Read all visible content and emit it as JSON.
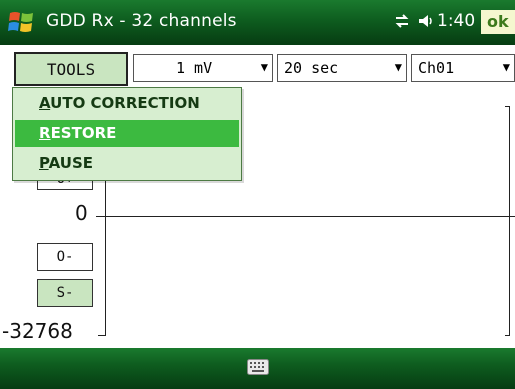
{
  "titlebar": {
    "title": "GDD Rx - 32 channels",
    "connectivity_icon": "connectivity-icon",
    "volume_icon": "speaker-icon",
    "clock": "1:40",
    "ok_label": "ok"
  },
  "toolbar": {
    "tools_label": "TOOLS",
    "gain": {
      "value": "1 mV"
    },
    "duration": {
      "value": "20 sec"
    },
    "channel": {
      "value": "Ch01"
    }
  },
  "menu": {
    "items": [
      {
        "first": "A",
        "rest": "UTO CORRECTION",
        "selected": false
      },
      {
        "first": "R",
        "rest": "ESTORE",
        "selected": true
      },
      {
        "first": "P",
        "rest": "AUSE",
        "selected": false
      }
    ]
  },
  "graph": {
    "y_zero": "0",
    "y_min": "-32768",
    "buttons": {
      "hidden": "O+",
      "offset_minus": "O-",
      "scale_minus": "S-"
    }
  },
  "bottombar": {
    "keyboard_icon": "keyboard-icon"
  },
  "colors": {
    "accent": "#3cba40",
    "bar": "#0e5d1f",
    "button_bg": "#c9e5c0"
  }
}
